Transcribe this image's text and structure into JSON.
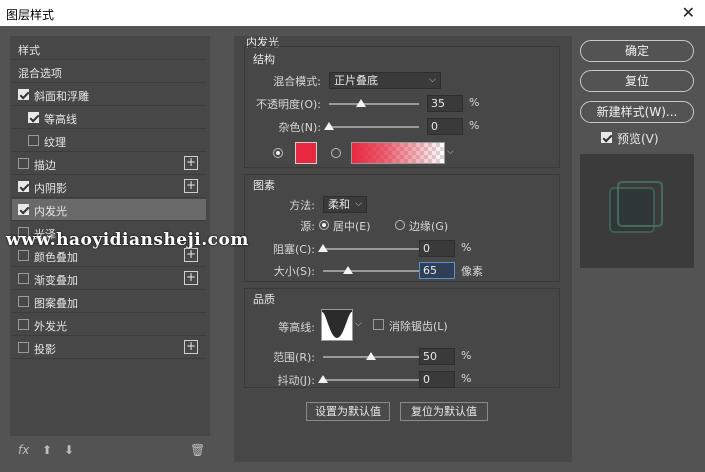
{
  "window": {
    "title": "图层样式",
    "close_label": "✕"
  },
  "left_panel": {
    "header": "样式",
    "items": [
      {
        "label": "混合选项",
        "checkbox": null,
        "plus": false,
        "selected": false
      },
      {
        "label": "斜面和浮雕",
        "checkbox": true,
        "plus": false,
        "selected": false
      },
      {
        "label": "等高线",
        "checkbox": true,
        "plus": false,
        "selected": false,
        "indent": true
      },
      {
        "label": "纹理",
        "checkbox": false,
        "plus": false,
        "selected": false,
        "indent": true
      },
      {
        "label": "描边",
        "checkbox": false,
        "plus": true,
        "selected": false
      },
      {
        "label": "内阴影",
        "checkbox": true,
        "plus": true,
        "selected": false
      },
      {
        "label": "内发光",
        "checkbox": true,
        "plus": false,
        "selected": true
      },
      {
        "label": "光泽",
        "checkbox": false,
        "plus": false,
        "selected": false
      },
      {
        "label": "颜色叠加",
        "checkbox": false,
        "plus": true,
        "selected": false
      },
      {
        "label": "渐变叠加",
        "checkbox": false,
        "plus": true,
        "selected": false
      },
      {
        "label": "图案叠加",
        "checkbox": false,
        "plus": false,
        "selected": false
      },
      {
        "label": "外发光",
        "checkbox": false,
        "plus": false,
        "selected": false
      },
      {
        "label": "投影",
        "checkbox": false,
        "plus": true,
        "selected": false
      }
    ],
    "footer": {
      "fx": "fx",
      "up": "⬆",
      "down": "⬇",
      "trash": "🗑"
    }
  },
  "inner_glow": {
    "title": "内发光",
    "structure": {
      "title": "结构",
      "blend_mode_label": "混合模式:",
      "blend_mode_value": "正片叠底",
      "opacity_label": "不透明度(O):",
      "opacity_value": "35",
      "opacity_fraction": 0.35,
      "noise_label": "杂色(N):",
      "noise_value": "0",
      "noise_fraction": 0,
      "percent": "%",
      "color": "#e8283f"
    },
    "elements": {
      "title": "图素",
      "method_label": "方法:",
      "method_value": "柔和",
      "source_label": "源:",
      "center_label": "居中(E)",
      "edge_label": "边缘(G)",
      "choke_label": "阻塞(C):",
      "choke_value": "0",
      "choke_fraction": 0,
      "size_label": "大小(S):",
      "size_value": "65",
      "size_fraction": 0.26,
      "size_unit": "像素",
      "percent": "%"
    },
    "quality": {
      "title": "品质",
      "contour_label": "等高线:",
      "antialias_label": "消除锯齿(L)",
      "range_label": "范围(R):",
      "range_value": "50",
      "range_fraction": 0.5,
      "jitter_label": "抖动(J):",
      "jitter_value": "0",
      "jitter_fraction": 0,
      "percent": "%"
    },
    "set_default_label": "设置为默认值",
    "reset_default_label": "复位为默认值"
  },
  "right_panel": {
    "ok_label": "确定",
    "reset_label": "复位",
    "new_style_label": "新建样式(W)...",
    "preview_label": "预览(V)"
  },
  "watermark": "www.haoyidiansheji.com"
}
